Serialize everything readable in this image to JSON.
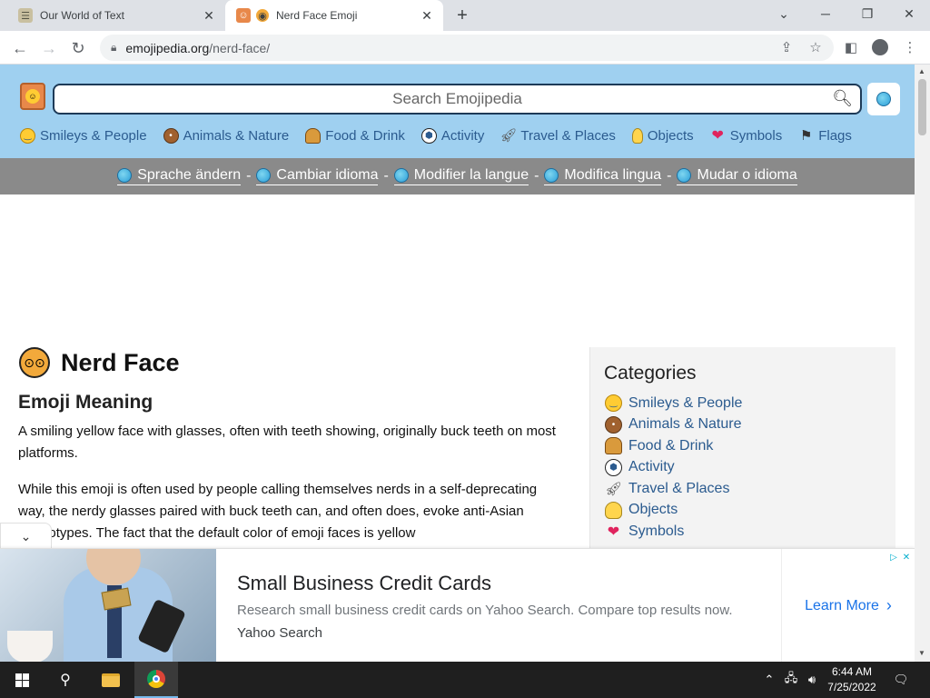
{
  "browser": {
    "tabs": [
      {
        "title": "Our World of Text",
        "active": false
      },
      {
        "title": "Nerd Face Emoji",
        "active": true
      }
    ],
    "url_host": "emojipedia.org",
    "url_path": "/nerd-face/"
  },
  "site": {
    "search_placeholder": "Search Emojipedia",
    "categories": [
      {
        "label": "Smileys & People",
        "icon": "smiley-icon"
      },
      {
        "label": "Animals & Nature",
        "icon": "bear-icon"
      },
      {
        "label": "Food & Drink",
        "icon": "burger-icon"
      },
      {
        "label": "Activity",
        "icon": "soccer-ball-icon"
      },
      {
        "label": "Travel & Places",
        "icon": "rocket-icon"
      },
      {
        "label": "Objects",
        "icon": "lightbulb-icon"
      },
      {
        "label": "Symbols",
        "icon": "heart-icon"
      },
      {
        "label": "Flags",
        "icon": "flag-icon"
      }
    ],
    "languages": [
      {
        "label": "Sprache ändern"
      },
      {
        "label": "Cambiar idioma"
      },
      {
        "label": "Modifier la langue"
      },
      {
        "label": "Modifica lingua"
      },
      {
        "label": "Mudar o idioma"
      }
    ],
    "lang_separator": "-"
  },
  "article": {
    "title": "Nerd Face",
    "section_heading": "Emoji Meaning",
    "paragraph1": "A smiling yellow face with glasses, often with teeth showing, originally buck teeth on most platforms.",
    "paragraph2": "While this emoji is often used by people calling themselves nerds in a self-deprecating way, the nerdy glasses paired with buck teeth can, and often does, evoke anti-Asian stereotypes. The fact that the default color of emoji faces is yellow"
  },
  "sidebar": {
    "title": "Categories",
    "items": [
      {
        "label": "Smileys & People",
        "icon": "smiley-icon"
      },
      {
        "label": "Animals & Nature",
        "icon": "bear-icon"
      },
      {
        "label": "Food & Drink",
        "icon": "burger-icon"
      },
      {
        "label": "Activity",
        "icon": "soccer-ball-icon"
      },
      {
        "label": "Travel & Places",
        "icon": "rocket-icon"
      },
      {
        "label": "Objects",
        "icon": "lightbulb-icon"
      },
      {
        "label": "Symbols",
        "icon": "heart-icon"
      }
    ]
  },
  "ad": {
    "title": "Small Business Credit Cards",
    "description": "Research small business credit cards on Yahoo Search. Compare top results now.",
    "source": "Yahoo Search",
    "cta": "Learn More"
  },
  "taskbar": {
    "time": "6:44 AM",
    "date": "7/25/2022"
  },
  "colors": {
    "header_bg": "#9fd0f0",
    "langbar_bg": "#8a8a8a",
    "link": "#2b5b8f",
    "ad_cta": "#1a73e8"
  }
}
